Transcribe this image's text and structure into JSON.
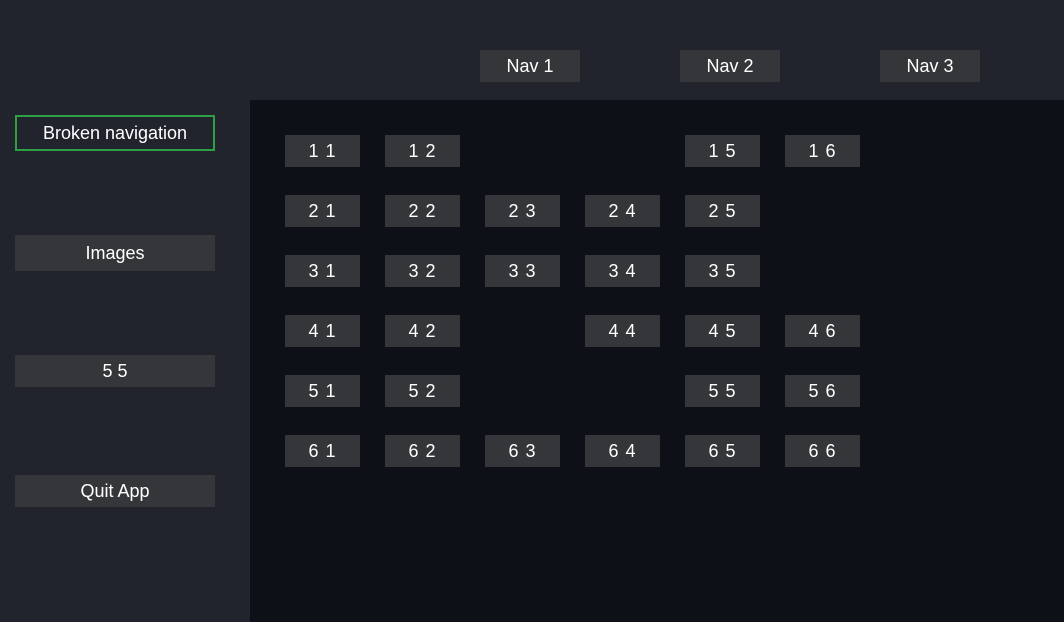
{
  "top_nav": {
    "items": [
      {
        "label": "Nav 1"
      },
      {
        "label": "Nav 2"
      },
      {
        "label": "Nav 3"
      }
    ]
  },
  "sidebar": {
    "items": [
      {
        "label": "Broken navigation",
        "focused": true
      },
      {
        "label": "Images",
        "focused": false
      },
      {
        "label": "5 5",
        "focused": false
      },
      {
        "label": "Quit App",
        "focused": false
      }
    ]
  },
  "grid": {
    "rows": [
      [
        "1 1",
        "1 2",
        "",
        "",
        "1 5",
        "1 6"
      ],
      [
        "2 1",
        "2 2",
        "2 3",
        "2 4",
        "2 5",
        ""
      ],
      [
        "3 1",
        "3 2",
        "3 3",
        "3 4",
        "3 5",
        ""
      ],
      [
        "4 1",
        "4 2",
        "",
        "4 4",
        "4 5",
        "4 6"
      ],
      [
        "5 1",
        "5 2",
        "",
        "",
        "5 5",
        "5 6"
      ],
      [
        "6 1",
        "6 2",
        "6 3",
        "6 4",
        "6 5",
        "6 6"
      ]
    ]
  },
  "colors": {
    "panel_bg": "#21242c",
    "content_bg": "#0d1016",
    "button_bg": "#343639",
    "focus_border": "#2ea043",
    "text": "#ffffff"
  }
}
